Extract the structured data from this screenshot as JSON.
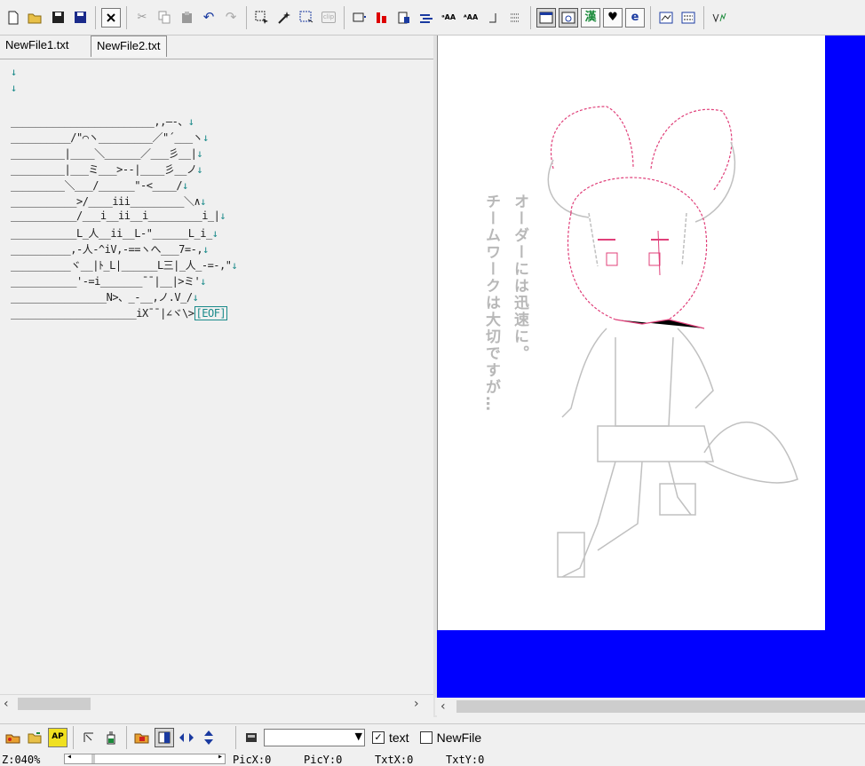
{
  "toolbar": {
    "icons": [
      "new-file-icon",
      "open-folder-icon",
      "save-icon",
      "save-as-icon",
      "close-x-icon",
      "cut-icon",
      "copy-icon",
      "paste-icon",
      "undo-icon",
      "redo-icon",
      "select-rect-icon",
      "magic-select-icon",
      "select-dashed-icon",
      "clip-icon",
      "text-frame-icon",
      "red-bars-icon",
      "page-icon",
      "align-icon",
      "aa-left-icon",
      "aa-right-icon",
      "space-icon",
      "grid-dots-icon",
      "window-icon",
      "zoom-window-icon",
      "kanji-icon",
      "heart-icon",
      "e-icon",
      "preview-icon",
      "aa-grid-icon",
      "ve-icon"
    ],
    "clip_label": "clip",
    "kanji_label": "漢",
    "e_label": "e"
  },
  "tabs": [
    {
      "label": "NewFile1.txt"
    },
    {
      "label": "NewFile2.txt",
      "active": true
    }
  ],
  "editor": {
    "lines": [
      {
        "text": "",
        "arrow": "↓"
      },
      {
        "text": "",
        "arrow": "↓"
      },
      {
        "text": "",
        "arrow": ""
      },
      {
        "text": "________________________,,–‐、",
        "arrow": "↓"
      },
      {
        "text": "__________/\"⌒ヽ_________／\"´___ヽ",
        "arrow": "↓"
      },
      {
        "text": "_________|____＼______／___彡__|",
        "arrow": "↓"
      },
      {
        "text": "_________|___ミ___>--|____彡__ノ",
        "arrow": "↓"
      },
      {
        "text": "_________＼___/______\"-<____/",
        "arrow": "↓"
      },
      {
        "text": "___________>/____iii_________＼∧",
        "arrow": "↓"
      },
      {
        "text": "___________/___i__ii__i_________i_|",
        "arrow": "↓"
      },
      {
        "text": "___________L_人__ii__L‐\"______L_i_",
        "arrow": "↓"
      },
      {
        "text": "__________,‐人‐^iV,‐==ヽへ___7=‐,",
        "arrow": "↓"
      },
      {
        "text": "__________ヾ__|ﾄ_L|______L三|_人_‐=‐,\"",
        "arrow": "↓"
      },
      {
        "text": "___________'‐=i_______¯¯|__|>ミ'",
        "arrow": "↓"
      },
      {
        "text": "________________N>、_‐__,ノ.V_/",
        "arrow": "↓"
      },
      {
        "text": "_____________________iX¯¯|∠ヾ\\>",
        "arrow": "",
        "eof": "[EOF]"
      }
    ]
  },
  "preview": {
    "caption_lines": [
      "オーダーには迅速に。",
      "チームワークは大切ですが…"
    ]
  },
  "bottom_toolbar": {
    "icons": [
      "printer-open-icon",
      "open-folder-icon",
      "ap-icon",
      "cursor-icon",
      "bottle-icon",
      "book-open-icon",
      "contrast-icon",
      "left-right-arrow-icon",
      "up-down-arrow-icon",
      "disk-icon"
    ],
    "ap_label": "AP",
    "combo_value": "",
    "text_checkbox": {
      "label": "text",
      "checked": true
    },
    "newfile_checkbox": {
      "label": "NewFile",
      "checked": false
    }
  },
  "status": {
    "zoom": "Z:040%",
    "picx": "PicX:0",
    "picy": "PicY:0",
    "txtx": "TxtX:0",
    "txty": "TxtY:0"
  },
  "colors": {
    "preview_bg": "#0000ff",
    "arrow": "#1a8a8a",
    "pink": "#e0407a",
    "gray_line": "#b0b0b0"
  }
}
